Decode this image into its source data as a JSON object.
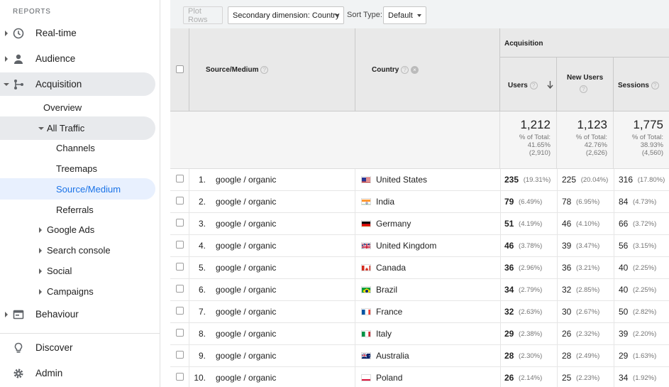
{
  "sidebar": {
    "section_heading": "REPORTS",
    "realtime": "Real-time",
    "audience": "Audience",
    "acquisition": "Acquisition",
    "overview": "Overview",
    "all_traffic": "All Traffic",
    "channels": "Channels",
    "treemaps": "Treemaps",
    "source_medium": "Source/Medium",
    "referrals": "Referrals",
    "google_ads": "Google Ads",
    "search_console": "Search console",
    "social": "Social",
    "campaigns": "Campaigns",
    "behaviour": "Behaviour",
    "discover": "Discover",
    "admin": "Admin"
  },
  "toolbar": {
    "plot_rows": "Plot Rows",
    "secondary_dimension": "Secondary dimension: Country",
    "sort_type_label": "Sort Type:",
    "sort_type_value": "Default"
  },
  "table": {
    "group_header": "Acquisition",
    "col_source": "Source/Medium",
    "col_country": "Country",
    "col_users": "Users",
    "col_new_users": "New Users",
    "col_sessions": "Sessions",
    "help_glyph": "?",
    "remove_glyph": "×",
    "totals": {
      "users": "1,212",
      "users_pct": "% of Total:",
      "users_pct2": "41.65%",
      "users_base": "(2,910)",
      "new_users": "1,123",
      "new_users_pct": "% of Total:",
      "new_users_pct2": "42.76%",
      "new_users_base": "(2,626)",
      "sessions": "1,775",
      "sessions_pct": "% of Total:",
      "sessions_pct2": "38.93%",
      "sessions_base": "(4,560)"
    },
    "rows": [
      {
        "idx": "1.",
        "source": "google / organic",
        "country": "United States",
        "flag": "us",
        "users": "235",
        "users_pct": "(19.31%)",
        "new_users": "225",
        "new_users_pct": "(20.04%)",
        "sessions": "316",
        "sessions_pct": "(17.80%)"
      },
      {
        "idx": "2.",
        "source": "google / organic",
        "country": "India",
        "flag": "in",
        "users": "79",
        "users_pct": "(6.49%)",
        "new_users": "78",
        "new_users_pct": "(6.95%)",
        "sessions": "84",
        "sessions_pct": "(4.73%)"
      },
      {
        "idx": "3.",
        "source": "google / organic",
        "country": "Germany",
        "flag": "de",
        "users": "51",
        "users_pct": "(4.19%)",
        "new_users": "46",
        "new_users_pct": "(4.10%)",
        "sessions": "66",
        "sessions_pct": "(3.72%)"
      },
      {
        "idx": "4.",
        "source": "google / organic",
        "country": "United Kingdom",
        "flag": "gb",
        "users": "46",
        "users_pct": "(3.78%)",
        "new_users": "39",
        "new_users_pct": "(3.47%)",
        "sessions": "56",
        "sessions_pct": "(3.15%)"
      },
      {
        "idx": "5.",
        "source": "google / organic",
        "country": "Canada",
        "flag": "ca",
        "users": "36",
        "users_pct": "(2.96%)",
        "new_users": "36",
        "new_users_pct": "(3.21%)",
        "sessions": "40",
        "sessions_pct": "(2.25%)"
      },
      {
        "idx": "6.",
        "source": "google / organic",
        "country": "Brazil",
        "flag": "br",
        "users": "34",
        "users_pct": "(2.79%)",
        "new_users": "32",
        "new_users_pct": "(2.85%)",
        "sessions": "40",
        "sessions_pct": "(2.25%)"
      },
      {
        "idx": "7.",
        "source": "google / organic",
        "country": "France",
        "flag": "fr",
        "users": "32",
        "users_pct": "(2.63%)",
        "new_users": "30",
        "new_users_pct": "(2.67%)",
        "sessions": "50",
        "sessions_pct": "(2.82%)"
      },
      {
        "idx": "8.",
        "source": "google / organic",
        "country": "Italy",
        "flag": "it",
        "users": "29",
        "users_pct": "(2.38%)",
        "new_users": "26",
        "new_users_pct": "(2.32%)",
        "sessions": "39",
        "sessions_pct": "(2.20%)"
      },
      {
        "idx": "9.",
        "source": "google / organic",
        "country": "Australia",
        "flag": "au",
        "users": "28",
        "users_pct": "(2.30%)",
        "new_users": "28",
        "new_users_pct": "(2.49%)",
        "sessions": "29",
        "sessions_pct": "(1.63%)"
      },
      {
        "idx": "10.",
        "source": "google / organic",
        "country": "Poland",
        "flag": "pl",
        "users": "26",
        "users_pct": "(2.14%)",
        "new_users": "25",
        "new_users_pct": "(2.23%)",
        "sessions": "34",
        "sessions_pct": "(1.92%)"
      }
    ]
  },
  "colors": {
    "accent": "#1a73e8",
    "active_bg": "#e8f0fe",
    "header_bg": "#e9e9e9"
  }
}
